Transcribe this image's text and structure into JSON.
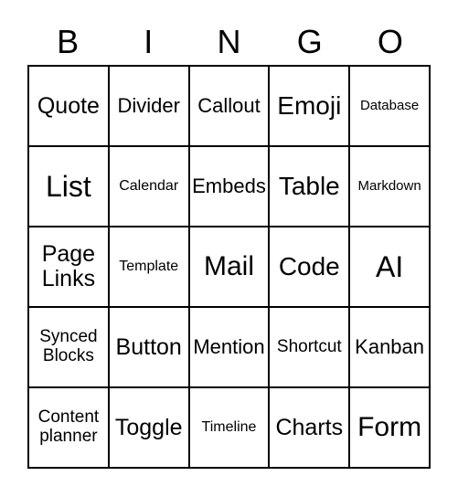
{
  "card": {
    "title": "BINGO",
    "headers": [
      "B",
      "I",
      "N",
      "G",
      "O"
    ],
    "rows": [
      [
        {
          "label": "Quote",
          "size": "fs-md"
        },
        {
          "label": "Divider",
          "size": "fs-sm"
        },
        {
          "label": "Callout",
          "size": "fs-sm"
        },
        {
          "label": "Emoji",
          "size": "fs-lg"
        },
        {
          "label": "Database",
          "size": "fs-tiny"
        }
      ],
      [
        {
          "label": "List",
          "size": "fs-xxl"
        },
        {
          "label": "Calendar",
          "size": "fs-xxs"
        },
        {
          "label": "Embeds",
          "size": "fs-sm"
        },
        {
          "label": "Table",
          "size": "fs-lg"
        },
        {
          "label": "Markdown",
          "size": "fs-tiny"
        }
      ],
      [
        {
          "label": "Page\nLinks",
          "size": "fs-md"
        },
        {
          "label": "Template",
          "size": "fs-xxs"
        },
        {
          "label": "Mail",
          "size": "fs-xl"
        },
        {
          "label": "Code",
          "size": "fs-lg"
        },
        {
          "label": "AI",
          "size": "fs-xxl"
        }
      ],
      [
        {
          "label": "Synced\nBlocks",
          "size": "fs-xs"
        },
        {
          "label": "Button",
          "size": "fs-md"
        },
        {
          "label": "Mention",
          "size": "fs-sm"
        },
        {
          "label": "Shortcut",
          "size": "fs-xs"
        },
        {
          "label": "Kanban",
          "size": "fs-sm"
        }
      ],
      [
        {
          "label": "Content\nplanner",
          "size": "fs-xs"
        },
        {
          "label": "Toggle",
          "size": "fs-md"
        },
        {
          "label": "Timeline",
          "size": "fs-xxs"
        },
        {
          "label": "Charts",
          "size": "fs-md"
        },
        {
          "label": "Form",
          "size": "fs-xl"
        }
      ]
    ]
  },
  "colors": {
    "background": "#ffffff",
    "border": "#000000",
    "text": "#000000"
  }
}
